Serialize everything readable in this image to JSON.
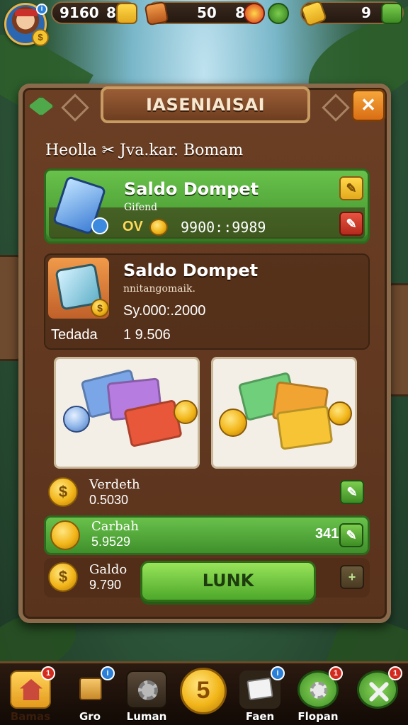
{
  "topbar": {
    "avatar_coin": "$",
    "avatar_info": "i",
    "resource1_value": "9160",
    "resource1_count": "8",
    "resource2_value": "50",
    "resource2_count": "8",
    "resource3_value": "9"
  },
  "panel": {
    "title": "IASENIAISAI",
    "close": "✕",
    "subtitle": "Heolla ✂ Jva.kar. Bomam"
  },
  "wallet_card": {
    "title": "Saldo Dompet",
    "subtitle": "Gifend",
    "currency": "OV",
    "value": "9900::9989",
    "edit_icon": "✎",
    "delete_icon": "✎"
  },
  "info_card": {
    "title": "Saldo Dompet",
    "subtitle": "nnitangomaik.",
    "value": "Sy.000:.2000",
    "label": "Tedada",
    "value2": "1 9.506",
    "icon_coin": "$"
  },
  "rows": [
    {
      "line1": "Verdeth",
      "line2": "0.5030",
      "coin": "$",
      "button": "✎"
    },
    {
      "line1": "Carbah",
      "line2": "5.9529",
      "coin": "",
      "extra": "341",
      "button": "✎"
    },
    {
      "line1": "Galdo",
      "line2": "9.790",
      "coin": "$",
      "button": "+"
    }
  ],
  "main_button": "LUNK",
  "nav": [
    {
      "label": "Bamas",
      "badge": "1"
    },
    {
      "label": "Gro",
      "badge": "i"
    },
    {
      "label": "Luman",
      "badge": ""
    },
    {
      "label": "",
      "badge": "",
      "center_glyph": "5"
    },
    {
      "label": "Faen",
      "badge": "i"
    },
    {
      "label": "Flopan",
      "badge": "1"
    },
    {
      "label": "",
      "badge": "1"
    }
  ],
  "colors": {
    "panel": "#6b3f24",
    "accent_green": "#4ea82a",
    "gold": "#f2b519",
    "close_orange": "#e07a1c"
  }
}
